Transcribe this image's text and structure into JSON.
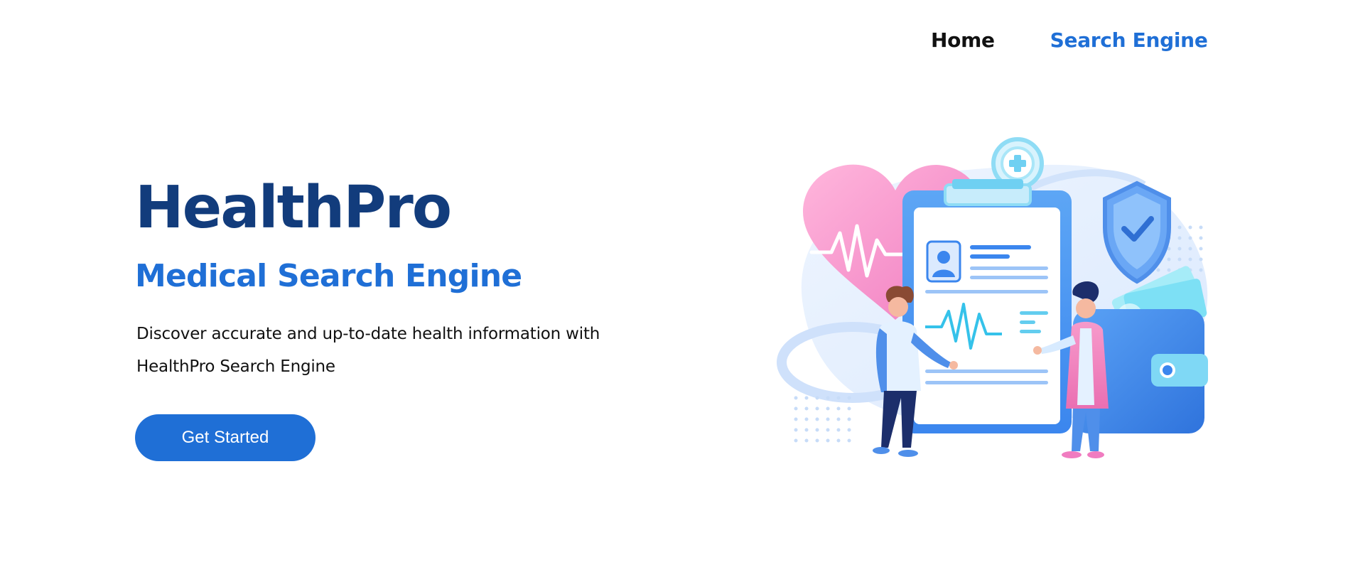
{
  "nav": {
    "items": [
      {
        "label": "Home",
        "active": false
      },
      {
        "label": "Search Engine",
        "active": true
      }
    ]
  },
  "hero": {
    "title": "HealthPro",
    "subtitle": "Medical Search Engine",
    "description": "Discover accurate and up-to-date health information with HealthPro Search Engine",
    "cta_label": "Get Started"
  },
  "illustration": {
    "subject": "doctors-with-medical-clipboard",
    "icons": [
      "heart-pulse-icon",
      "plus-circle-icon",
      "shield-check-icon",
      "wallet-icon",
      "patient-profile-icon",
      "heartbeat-chart-icon"
    ]
  },
  "colors": {
    "brand_dark": "#123c7c",
    "brand": "#1f6fd6",
    "text": "#111111",
    "background": "#ffffff"
  }
}
